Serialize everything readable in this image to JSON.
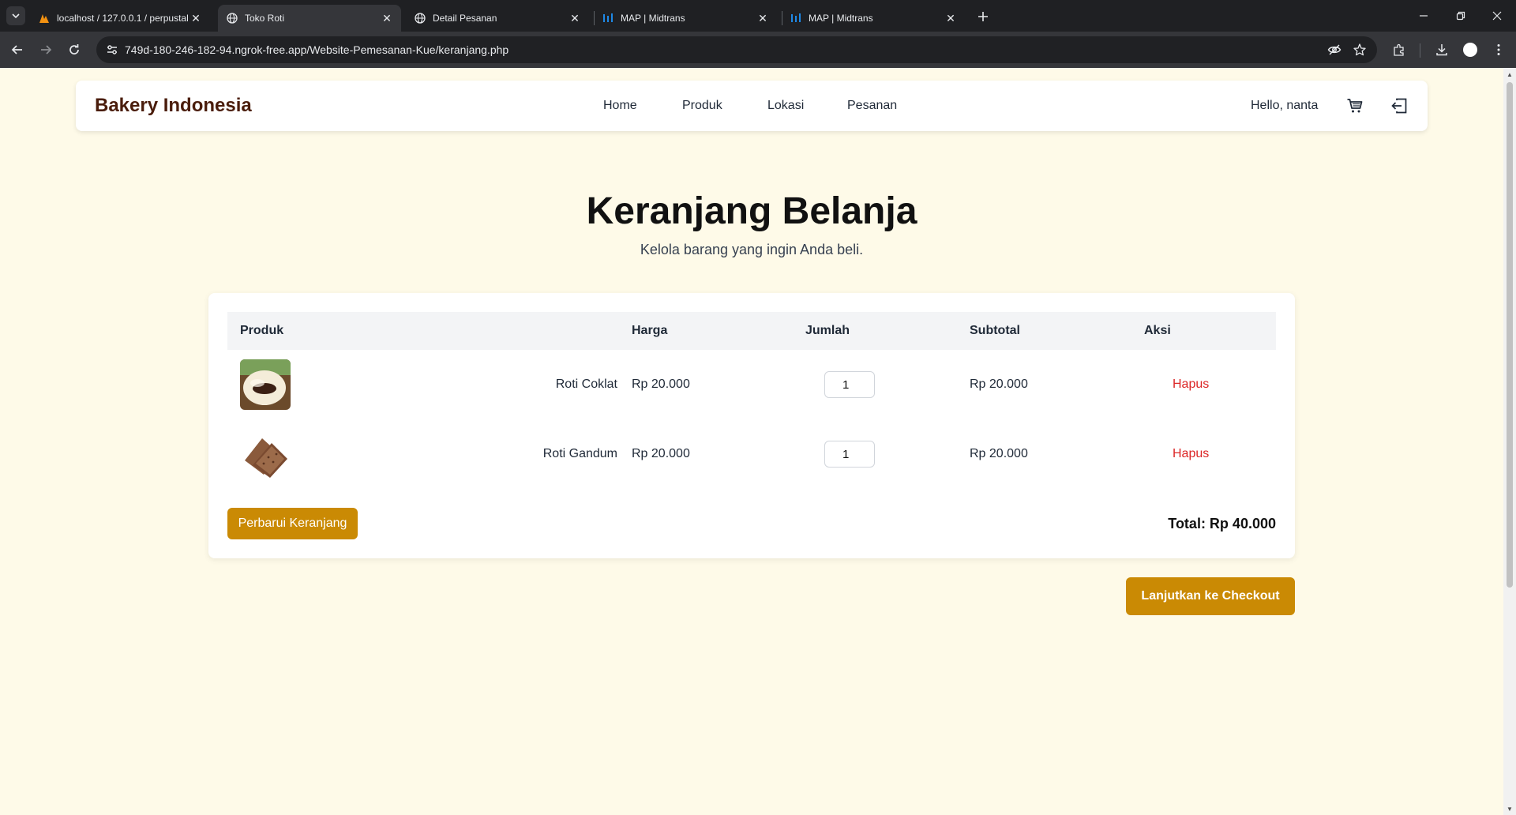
{
  "browser": {
    "tabs": [
      {
        "title": "localhost / 127.0.0.1 / perpustal",
        "icon": "phpmyadmin-icon"
      },
      {
        "title": "Toko Roti",
        "icon": "globe-icon",
        "active": true
      },
      {
        "title": "Detail Pesanan",
        "icon": "globe-icon"
      },
      {
        "title": "MAP | Midtrans",
        "icon": "midtrans-icon"
      },
      {
        "title": "MAP | Midtrans",
        "icon": "midtrans-icon"
      }
    ],
    "url": "749d-180-246-182-94.ngrok-free.app/Website-Pemesanan-Kue/keranjang.php"
  },
  "header": {
    "brand": "Bakery Indonesia",
    "nav": [
      "Home",
      "Produk",
      "Lokasi",
      "Pesanan"
    ],
    "greeting": "Hello, nanta"
  },
  "page": {
    "title": "Keranjang Belanja",
    "subtitle": "Kelola barang yang ingin Anda beli."
  },
  "cart": {
    "columns": [
      "Produk",
      "Harga",
      "Jumlah",
      "Subtotal",
      "Aksi"
    ],
    "items": [
      {
        "name": "Roti Coklat",
        "price": "Rp 20.000",
        "qty": "1",
        "subtotal": "Rp 20.000",
        "action": "Hapus"
      },
      {
        "name": "Roti Gandum",
        "price": "Rp 20.000",
        "qty": "1",
        "subtotal": "Rp 20.000",
        "action": "Hapus"
      }
    ],
    "update_label": "Perbarui Keranjang",
    "total": "Total: Rp 40.000"
  },
  "checkout_label": "Lanjutkan ke Checkout",
  "colors": {
    "page_bg": "#fefae8",
    "brand": "#4a1d0c",
    "accent": "#ca8a04",
    "danger": "#dc2626"
  }
}
